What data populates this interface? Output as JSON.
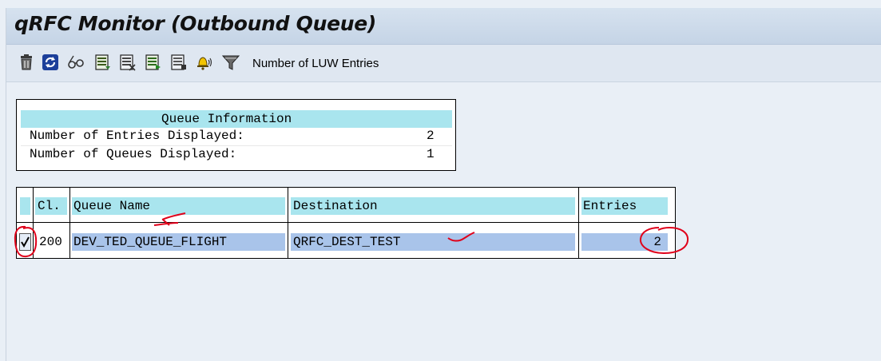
{
  "window": {
    "title": "qRFC Monitor (Outbound Queue)"
  },
  "toolbar": {
    "buttons": [
      {
        "icon": "delete-icon"
      },
      {
        "icon": "refresh-icon"
      },
      {
        "icon": "display-details-icon"
      },
      {
        "icon": "lock-queue-icon"
      },
      {
        "icon": "unlock-queue-icon"
      },
      {
        "icon": "activate-queue-icon"
      },
      {
        "icon": "deactivate-queue-icon"
      },
      {
        "icon": "alert-icon"
      },
      {
        "icon": "filter-icon"
      }
    ],
    "luw_label": "Number of LUW Entries"
  },
  "queue_info": {
    "title": "Queue Information",
    "rows": [
      {
        "label": "Number of Entries Displayed:",
        "value": "2"
      },
      {
        "label": "Number of Queues Displayed:",
        "value": "1"
      }
    ]
  },
  "queue_table": {
    "columns": [
      "Cl.",
      "Queue Name",
      "Destination",
      "Entries"
    ],
    "rows": [
      {
        "selected": true,
        "client": "200",
        "queue_name": "DEV_TED_QUEUE_FLIGHT",
        "destination": "QRFC_DEST_TEST",
        "entries": "2"
      }
    ]
  },
  "colors": {
    "header_cyan": "#a9e5ee",
    "selected_row_blue": "#a9c4ea",
    "annotation_red": "#e0001a"
  }
}
